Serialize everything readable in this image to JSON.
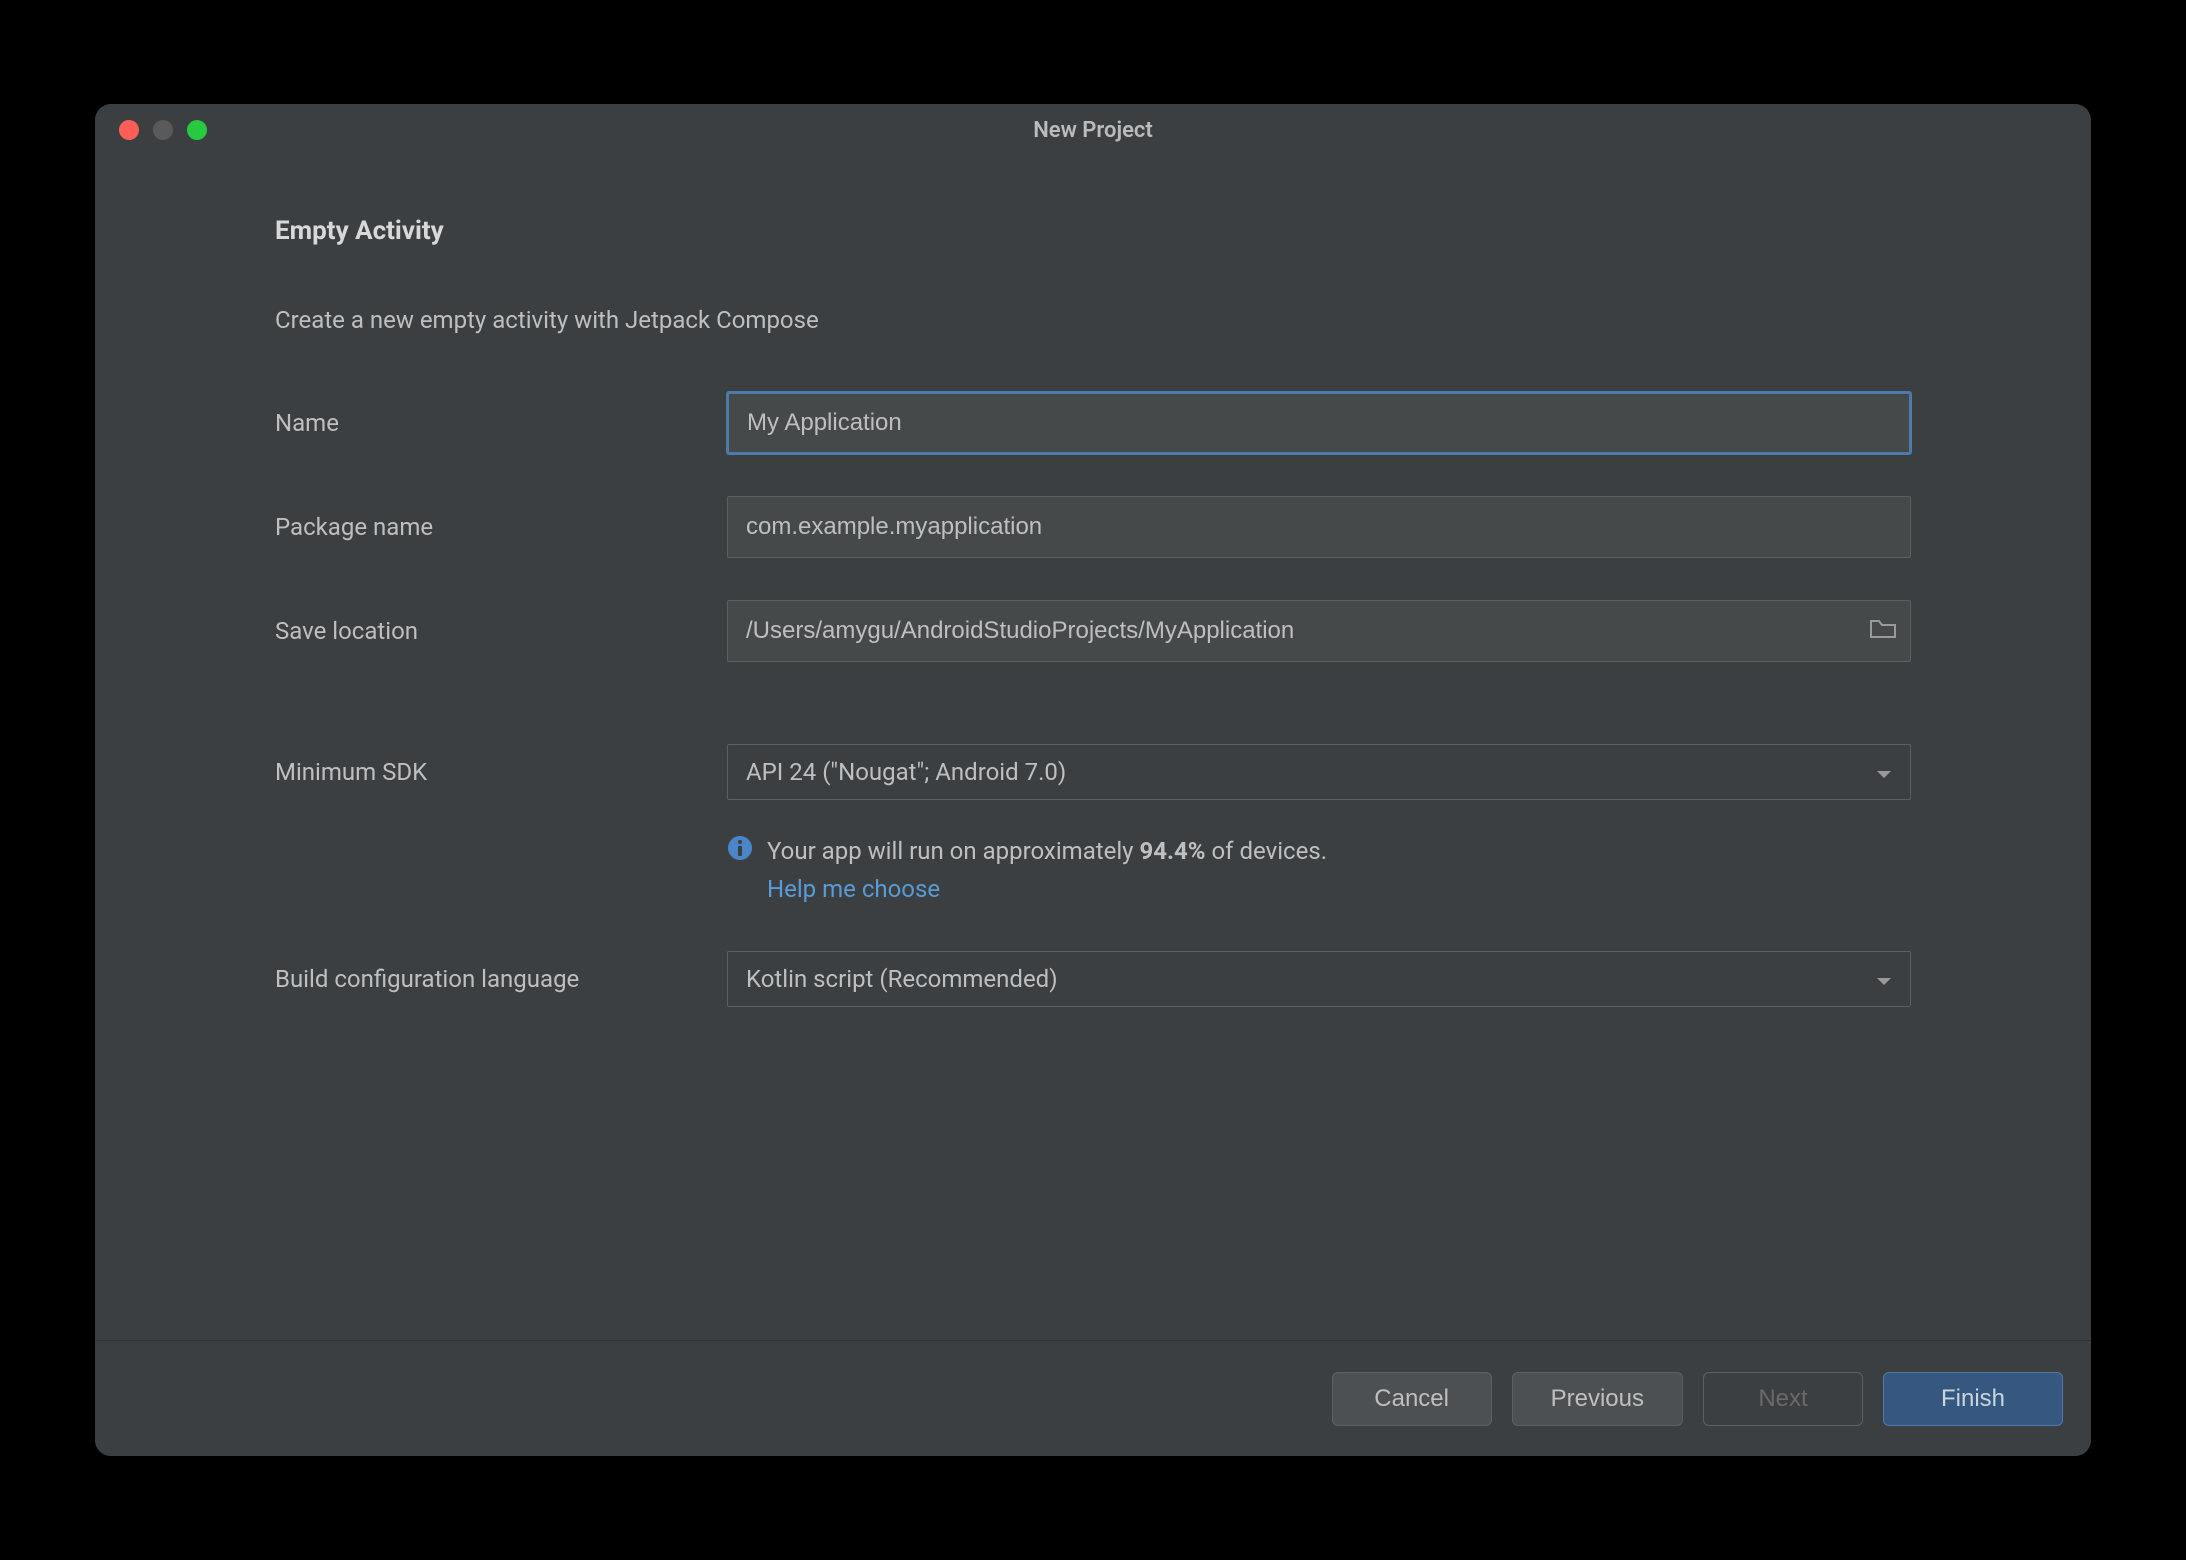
{
  "window": {
    "title": "New Project"
  },
  "page": {
    "heading": "Empty Activity",
    "description": "Create a new empty activity with Jetpack Compose"
  },
  "form": {
    "name": {
      "label": "Name",
      "value": "My Application"
    },
    "package": {
      "label": "Package name",
      "value": "com.example.myapplication"
    },
    "location": {
      "label": "Save location",
      "value": "/Users/amygu/AndroidStudioProjects/MyApplication"
    },
    "sdk": {
      "label": "Minimum SDK",
      "value": "API 24 (\"Nougat\"; Android 7.0)"
    },
    "buildlang": {
      "label": "Build configuration language",
      "value": "Kotlin script (Recommended)"
    }
  },
  "hint": {
    "line1_prefix": "Your app will run on approximately ",
    "percent": "94.4%",
    "line1_suffix": " of devices.",
    "help_link": "Help me choose"
  },
  "buttons": {
    "cancel": "Cancel",
    "previous": "Previous",
    "next": "Next",
    "finish": "Finish"
  }
}
